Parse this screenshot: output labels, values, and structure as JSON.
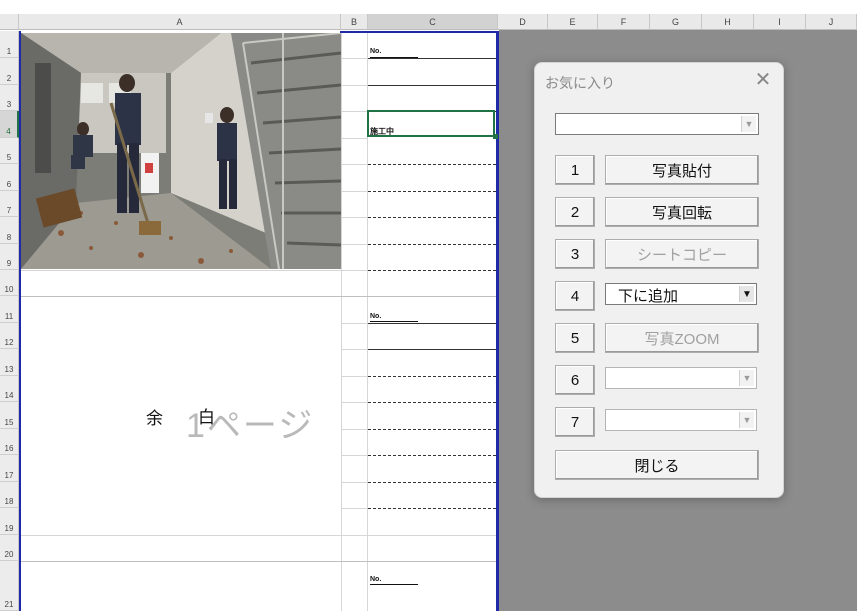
{
  "spreadsheet": {
    "columns": [
      "A",
      "B",
      "C",
      "D",
      "E",
      "F",
      "G",
      "H",
      "I",
      "J"
    ],
    "selected_column": "C",
    "rows": [
      "1",
      "2",
      "3",
      "4",
      "5",
      "6",
      "7",
      "8",
      "9",
      "10",
      "11",
      "12",
      "13",
      "14",
      "15",
      "16",
      "17",
      "18",
      "19",
      "20",
      "21"
    ],
    "selected_row": "4",
    "no_label": "No.",
    "status_label": "施工中",
    "yohaku_left": "余",
    "yohaku_right": "白",
    "page_watermark": "1ページ"
  },
  "dialog": {
    "title": "お気に入り",
    "close_symbol": "✕",
    "top_combo_value": "",
    "items": [
      {
        "number": "1",
        "label": "写真貼付",
        "type": "button",
        "enabled": true
      },
      {
        "number": "2",
        "label": "写真回転",
        "type": "button",
        "enabled": true
      },
      {
        "number": "3",
        "label": "シートコピー",
        "type": "button",
        "enabled": false
      },
      {
        "number": "4",
        "label": "下に追加",
        "type": "combo",
        "enabled": true
      },
      {
        "number": "5",
        "label": "写真ZOOM",
        "type": "button",
        "enabled": false
      },
      {
        "number": "6",
        "label": "",
        "type": "combo",
        "enabled": false
      },
      {
        "number": "7",
        "label": "",
        "type": "combo",
        "enabled": false
      }
    ],
    "close_button": "閉じる"
  }
}
